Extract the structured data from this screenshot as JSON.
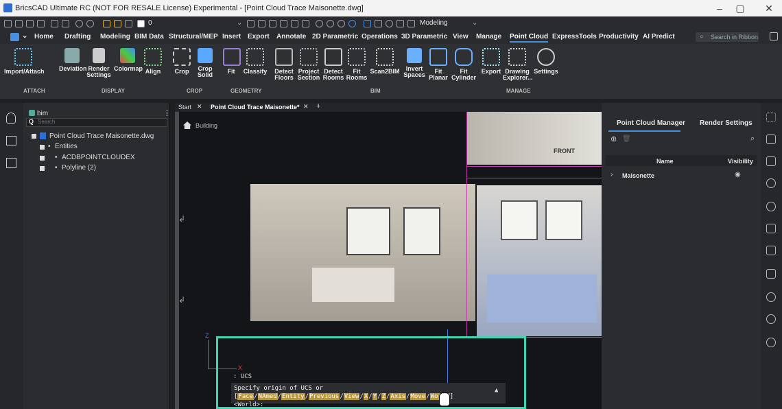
{
  "window": {
    "title": "BricsCAD Ultimate RC (NOT FOR RESALE License) Experimental - [Point Cloud Trace Maisonette.dwg]",
    "min": "–",
    "max": "▢",
    "close": "✕"
  },
  "qat": {
    "layer_value": "0",
    "workspace": "Modeling"
  },
  "ribbon_tabs": [
    "Home",
    "Drafting",
    "Modeling",
    "BIM Data",
    "Structural/MEP",
    "Insert",
    "Export",
    "Annotate",
    "2D Parametric",
    "Operations",
    "3D Parametric",
    "View",
    "Manage",
    "Point Cloud",
    "ExpressTools",
    "Productivity",
    "AI Predict"
  ],
  "active_tab": "Point Cloud",
  "search_placeholder": "Search in Ribbon",
  "ribbon_buttons": [
    {
      "label": "Import/Attach"
    },
    {
      "label": "Deviation"
    },
    {
      "label": "Render Settings"
    },
    {
      "label": "Colormap"
    },
    {
      "label": "Align"
    },
    {
      "label": "Crop"
    },
    {
      "label": "Crop Solid"
    },
    {
      "label": "Fit"
    },
    {
      "label": "Classify"
    },
    {
      "label": "Detect Floors"
    },
    {
      "label": "Project Section"
    },
    {
      "label": "Detect Rooms"
    },
    {
      "label": "Fit Rooms"
    },
    {
      "label": "Scan2BIM"
    },
    {
      "label": "Invert Spaces"
    },
    {
      "label": "Fit Planar"
    },
    {
      "label": "Fit Cylinder"
    },
    {
      "label": "Export"
    },
    {
      "label": "Drawing Explorer..."
    },
    {
      "label": "Settings"
    }
  ],
  "ribbon_groups": [
    "ATTACH",
    "DISPLAY",
    "CROP",
    "GEOMETRY",
    "BIM",
    "MANAGE"
  ],
  "tree": {
    "root_label": "bim",
    "search_placeholder": "Search",
    "items": [
      {
        "label": "Point Cloud Trace Maisonette.dwg"
      },
      {
        "label": "Entities"
      },
      {
        "label": "ACDBPOINTCLOUDEX"
      },
      {
        "label": "Polyline (2)"
      }
    ]
  },
  "doc_tabs": [
    {
      "label": "Start"
    },
    {
      "label": "Point Cloud Trace Maisonette*"
    }
  ],
  "viewport": {
    "breadcrumb": "Building",
    "view_label": "FRONT"
  },
  "right_panel": {
    "tabs": [
      "Point Cloud Manager",
      "Render Settings"
    ],
    "columns": [
      "Name",
      "Visibility"
    ],
    "rows": [
      {
        "name": "Maisonette"
      }
    ]
  },
  "ucs": {
    "z": "Z",
    "x": "X"
  },
  "command": {
    "history": ": UCS",
    "prompt_prefix": "Specify origin of UCS or [",
    "options": [
      "Face",
      "NAmed",
      "Entity",
      "Previous",
      "View",
      "X",
      "Y",
      "Z",
      "Axis",
      "Move",
      "World"
    ],
    "prompt_suffix": "] <World>:"
  },
  "colors": {
    "accent": "#4a8fe0",
    "highlight_box": "#3dd6b0",
    "keyword": "#b9973e"
  }
}
